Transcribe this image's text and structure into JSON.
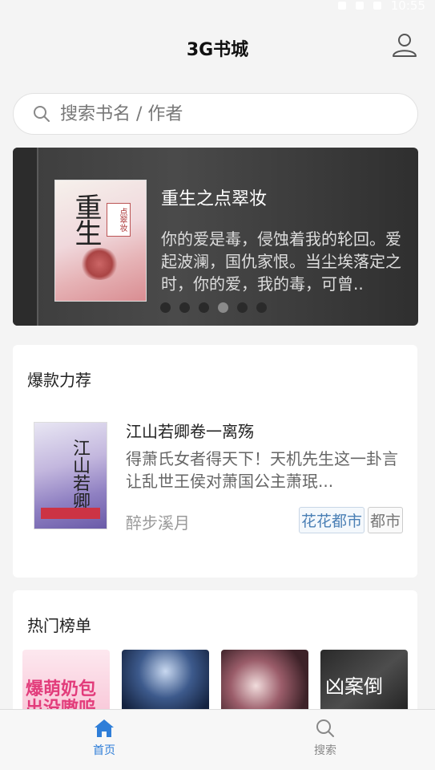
{
  "status_bar": {
    "time": "10:55"
  },
  "header": {
    "title": "3G书城"
  },
  "search": {
    "placeholder": "搜索书名 / 作者"
  },
  "banner": {
    "title": "重生之点翠妆",
    "description": "你的爱是毒，侵蚀着我的轮回。爱起波澜，国仇家恨。当尘埃落定之时，你的爱，我的毒，可曾..",
    "cover_title": "重生",
    "cover_tag": "点翠妆",
    "dots": 6,
    "active_dot": 4
  },
  "recommend": {
    "title": "爆款力荐",
    "book": {
      "title": "江山若卿卷一离殇",
      "description": "得萧氏女者得天下！天机先生这一卦言让乱世王侯对萧国公主萧珉...",
      "author": "醉步溪月",
      "cover_title": "江山若卿",
      "tags": [
        "花花都市",
        "都市"
      ]
    }
  },
  "hot": {
    "title": "热门榜单",
    "covers": [
      {
        "text": "爆萌奶包出没嗷呜"
      },
      {
        "text": ""
      },
      {
        "text": ""
      },
      {
        "text": "凶案倒"
      }
    ]
  },
  "nav": {
    "home_label": "首页",
    "search_label": "搜索",
    "active_color": "#2f7ed8"
  }
}
